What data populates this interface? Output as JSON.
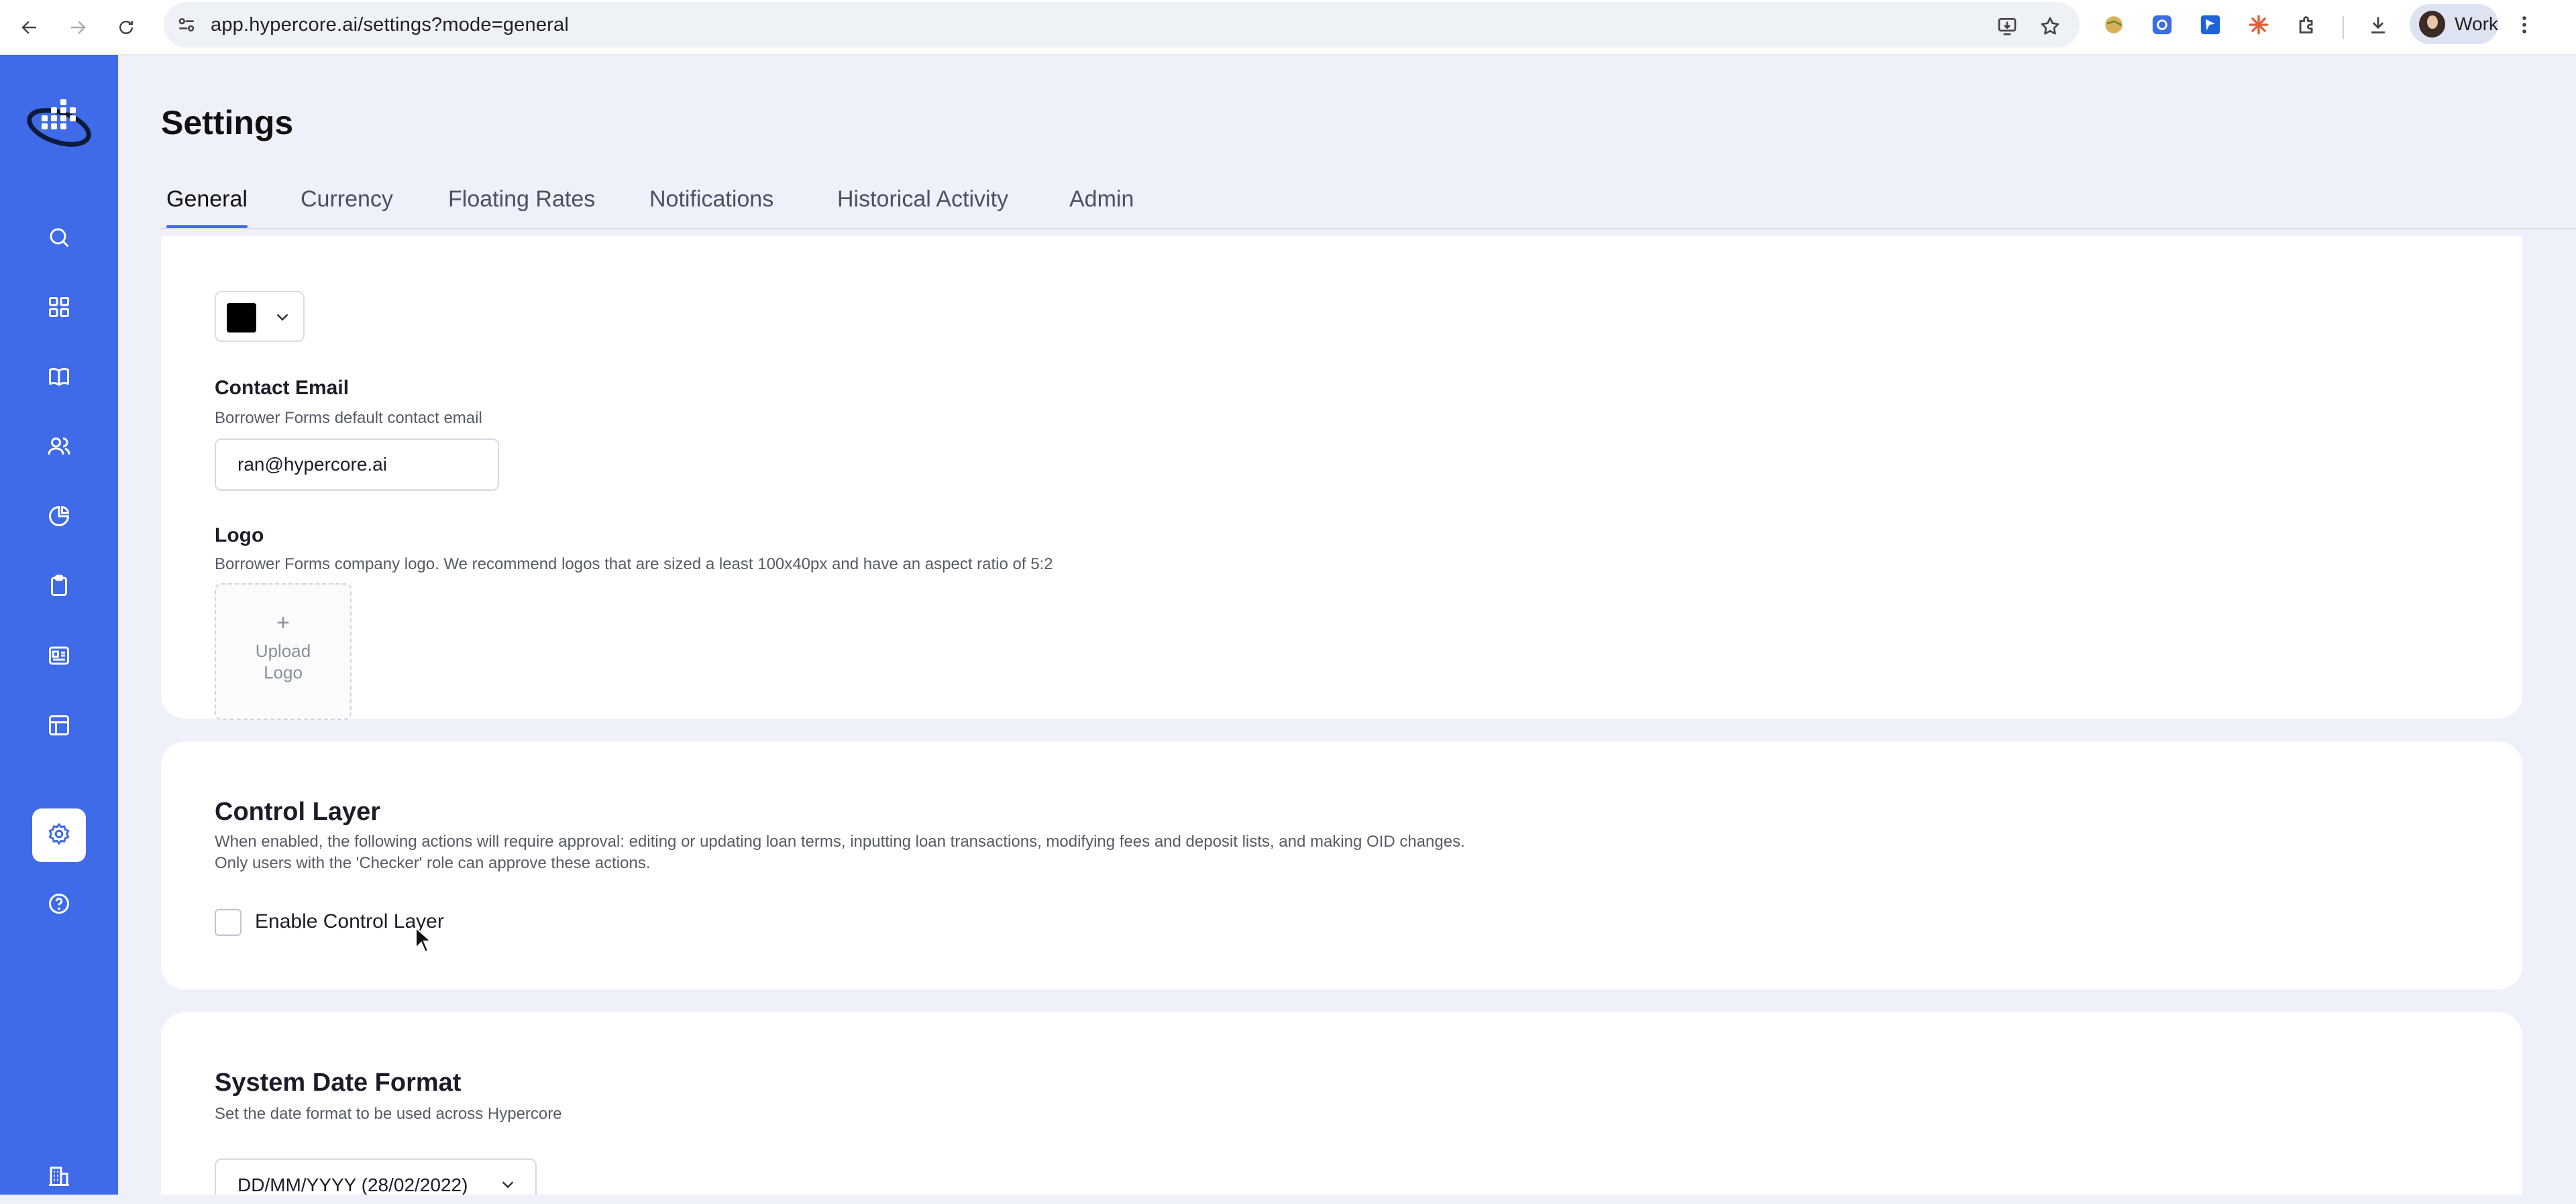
{
  "browser": {
    "url": "app.hypercore.ai/settings?mode=general",
    "profile_label": "Work",
    "icons": [
      "back-icon",
      "forward-icon",
      "reload-icon",
      "site-settings-icon",
      "install-app-icon",
      "bookmark-star-icon",
      "extension-icon",
      "download-icon",
      "more-menu-icon"
    ]
  },
  "sidebar": {
    "items": [
      {
        "icon": "search-icon"
      },
      {
        "icon": "dashboard-grid-icon"
      },
      {
        "icon": "book-icon"
      },
      {
        "icon": "users-icon"
      },
      {
        "icon": "pie-chart-icon"
      },
      {
        "icon": "clipboard-icon"
      },
      {
        "icon": "card-list-icon"
      },
      {
        "icon": "table-icon"
      },
      {
        "icon": "gear-icon",
        "active": true
      },
      {
        "icon": "help-icon"
      },
      {
        "icon": "building-icon"
      }
    ],
    "accent": "#3f6ae8"
  },
  "page": {
    "title": "Settings",
    "tabs": [
      {
        "label": "General",
        "active": true
      },
      {
        "label": "Currency"
      },
      {
        "label": "Floating Rates"
      },
      {
        "label": "Notifications"
      },
      {
        "label": "Historical Activity"
      },
      {
        "label": "Admin"
      }
    ]
  },
  "borrower_forms": {
    "color_value": "#000000",
    "contact_email": {
      "label": "Contact Email",
      "description": "Borrower Forms default contact email",
      "value": "ran@hypercore.ai"
    },
    "logo": {
      "label": "Logo",
      "description": "Borrower Forms company logo. We recommend logos that are sized a least 100x40px and have an aspect ratio of 5:2",
      "upload_plus": "+",
      "upload_line1": "Upload",
      "upload_line2": "Logo"
    }
  },
  "control_layer": {
    "title": "Control Layer",
    "description_line1": "When enabled, the following actions will require approval: editing or updating loan terms, inputting loan transactions, modifying fees and deposit lists, and making OID changes.",
    "description_line2": "Only users with the 'Checker' role can approve these actions.",
    "checkbox_label": "Enable Control Layer",
    "checked": false
  },
  "system_date_format": {
    "title": "System Date Format",
    "description": "Set the date format to be used across Hypercore",
    "selected": "DD/MM/YYYY (28/02/2022)"
  }
}
